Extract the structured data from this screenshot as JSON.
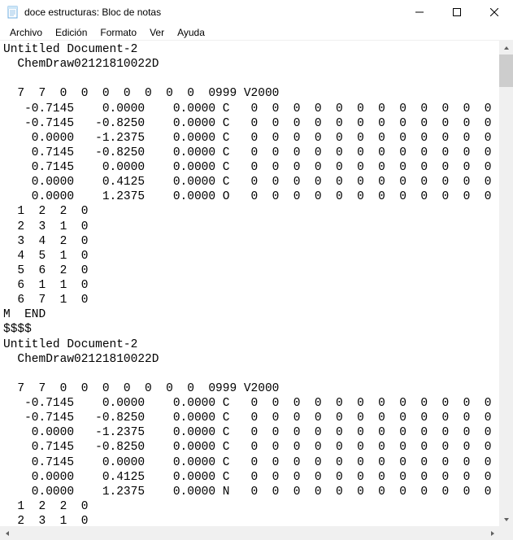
{
  "window": {
    "title": "doce estructuras: Bloc de notas"
  },
  "menu": {
    "items": [
      "Archivo",
      "Edición",
      "Formato",
      "Ver",
      "Ayuda"
    ]
  },
  "editor": {
    "content": "Untitled Document-2\n  ChemDraw02121810022D\n\n  7  7  0  0  0  0  0  0  0  0999 V2000\n   -0.7145    0.0000    0.0000 C   0  0  0  0  0  0  0  0  0  0  0  0\n   -0.7145   -0.8250    0.0000 C   0  0  0  0  0  0  0  0  0  0  0  0\n    0.0000   -1.2375    0.0000 C   0  0  0  0  0  0  0  0  0  0  0  0\n    0.7145   -0.8250    0.0000 C   0  0  0  0  0  0  0  0  0  0  0  0\n    0.7145    0.0000    0.0000 C   0  0  0  0  0  0  0  0  0  0  0  0\n    0.0000    0.4125    0.0000 C   0  0  0  0  0  0  0  0  0  0  0  0\n    0.0000    1.2375    0.0000 O   0  0  0  0  0  0  0  0  0  0  0  0\n  1  2  2  0\n  2  3  1  0\n  3  4  2  0\n  4  5  1  0\n  5  6  2  0\n  6  1  1  0\n  6  7  1  0\nM  END\n$$$$\nUntitled Document-2\n  ChemDraw02121810022D\n\n  7  7  0  0  0  0  0  0  0  0999 V2000\n   -0.7145    0.0000    0.0000 C   0  0  0  0  0  0  0  0  0  0  0  0\n   -0.7145   -0.8250    0.0000 C   0  0  0  0  0  0  0  0  0  0  0  0\n    0.0000   -1.2375    0.0000 C   0  0  0  0  0  0  0  0  0  0  0  0\n    0.7145   -0.8250    0.0000 C   0  0  0  0  0  0  0  0  0  0  0  0\n    0.7145    0.0000    0.0000 C   0  0  0  0  0  0  0  0  0  0  0  0\n    0.0000    0.4125    0.0000 C   0  0  0  0  0  0  0  0  0  0  0  0\n    0.0000    1.2375    0.0000 N   0  0  0  0  0  0  0  0  0  0  0  0\n  1  2  2  0\n  2  3  1  0"
  }
}
